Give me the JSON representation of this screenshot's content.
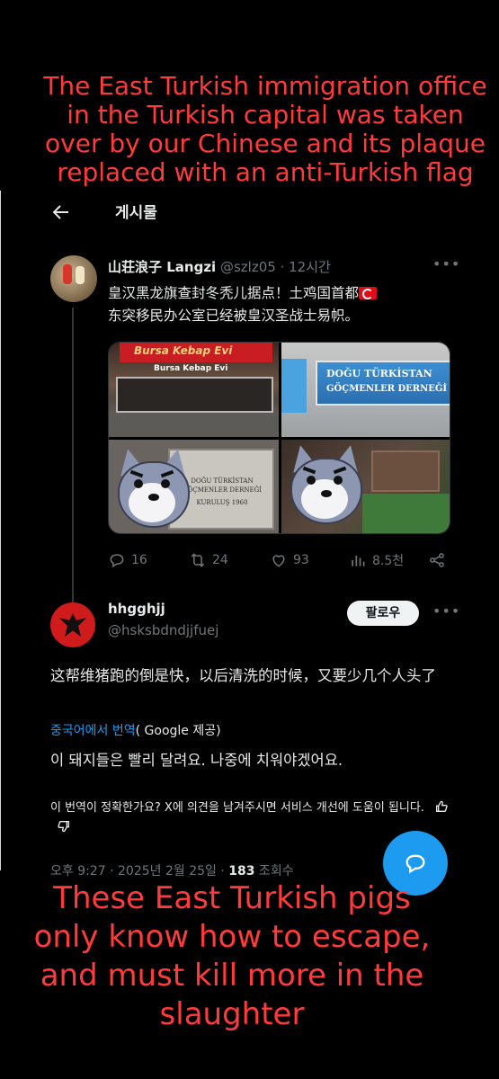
{
  "header": {
    "title": "게시물",
    "back_icon": "back-arrow-icon"
  },
  "captions": {
    "top": "The East Turkish immigration office in the Turkish capital was taken over by our Chinese and its plaque replaced with an anti-Turkish flag",
    "bottom": "These East Turkish pigs only know how to escape, and must kill more in the slaughter"
  },
  "tweet": {
    "author_name": "山荘浪子 Langzi",
    "meta": "@szlz05 · 12시간",
    "text_line1": "皇汉黑龙旗查封冬秃儿据点！土鸡国首都",
    "text_line2": "东突移民办公室已经被皇汉圣战士易帜。",
    "flag_icon": "turkey-flag-icon",
    "media": {
      "image1_sign": "Bursa Kebap Evi",
      "image1_subsign": "Bursa Kebap Evi",
      "image2_plaque_line1": "DOĞU TÜRKİSTAN",
      "image2_plaque_line2": "GÖÇMENLER DERNEĞİ",
      "image3_plate_line1": "DOĞU TÜRKİSTAN",
      "image3_plate_line2": "GÖÇMENLER DERNEĞİ",
      "image3_plate_line3": "KURULUŞ 1960"
    },
    "actions": {
      "replies": "16",
      "reposts": "24",
      "likes": "93",
      "views": "8.5천"
    }
  },
  "reply": {
    "author_name": "hhgghjj",
    "handle": "@hsksbdndjjfuej",
    "follow_label": "팔로우",
    "text": "这帮维猪跑的倒是快，以后清洗的时候，又要少几个人头了",
    "translate_link": "중국어에서 번역",
    "translate_provider": "( Google 제공)",
    "translated_text": "이 돼지들은 빨리 달려요. 나중에 치워야겠어요.",
    "feedback_text": "이 번역이 정확한가요? X에 의견을 남겨주시면 서비스 개선에 도움이 됩니다.",
    "timestamp": "오후 9:27 · 2025년 2월 25일 · ",
    "views_count": "183",
    "views_label": " 조회수"
  },
  "colors": {
    "accent": "#1d9bf0",
    "caption": "#ff3b3b",
    "muted": "#71767b"
  }
}
